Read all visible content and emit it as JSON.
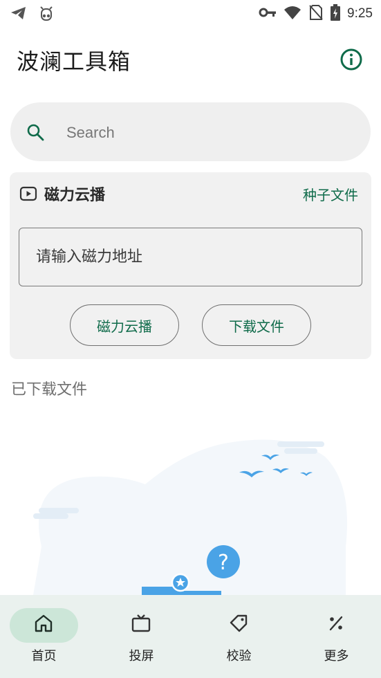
{
  "status_bar": {
    "time": "9:25",
    "left_icons": [
      "telegram-icon",
      "cow-icon"
    ],
    "right_icons": [
      "vpn-key-icon",
      "wifi-icon",
      "no-sim-icon",
      "battery-charging-icon"
    ]
  },
  "header": {
    "title": "波澜工具箱",
    "info_icon": "info-icon"
  },
  "search": {
    "placeholder": "Search",
    "value": ""
  },
  "magnet_card": {
    "title": "磁力云播",
    "torrent_link": "种子文件",
    "input_placeholder": "请输入磁力地址",
    "input_value": "",
    "buttons": {
      "play": "磁力云播",
      "download": "下载文件"
    }
  },
  "downloads": {
    "label": "已下载文件"
  },
  "bottom_nav": {
    "active": "home",
    "items": [
      {
        "label": "首页",
        "icon": "home-icon"
      },
      {
        "label": "投屏",
        "icon": "tv-icon"
      },
      {
        "label": "校验",
        "icon": "tag-icon"
      },
      {
        "label": "更多",
        "icon": "percent-icon"
      }
    ]
  },
  "colors": {
    "accent": "#0f6b4a",
    "nav_background": "#eaf1ee",
    "nav_active_pill": "#cce6d8",
    "card_background": "#f1f1f1",
    "illustration_blue": "#4aa3e6"
  }
}
